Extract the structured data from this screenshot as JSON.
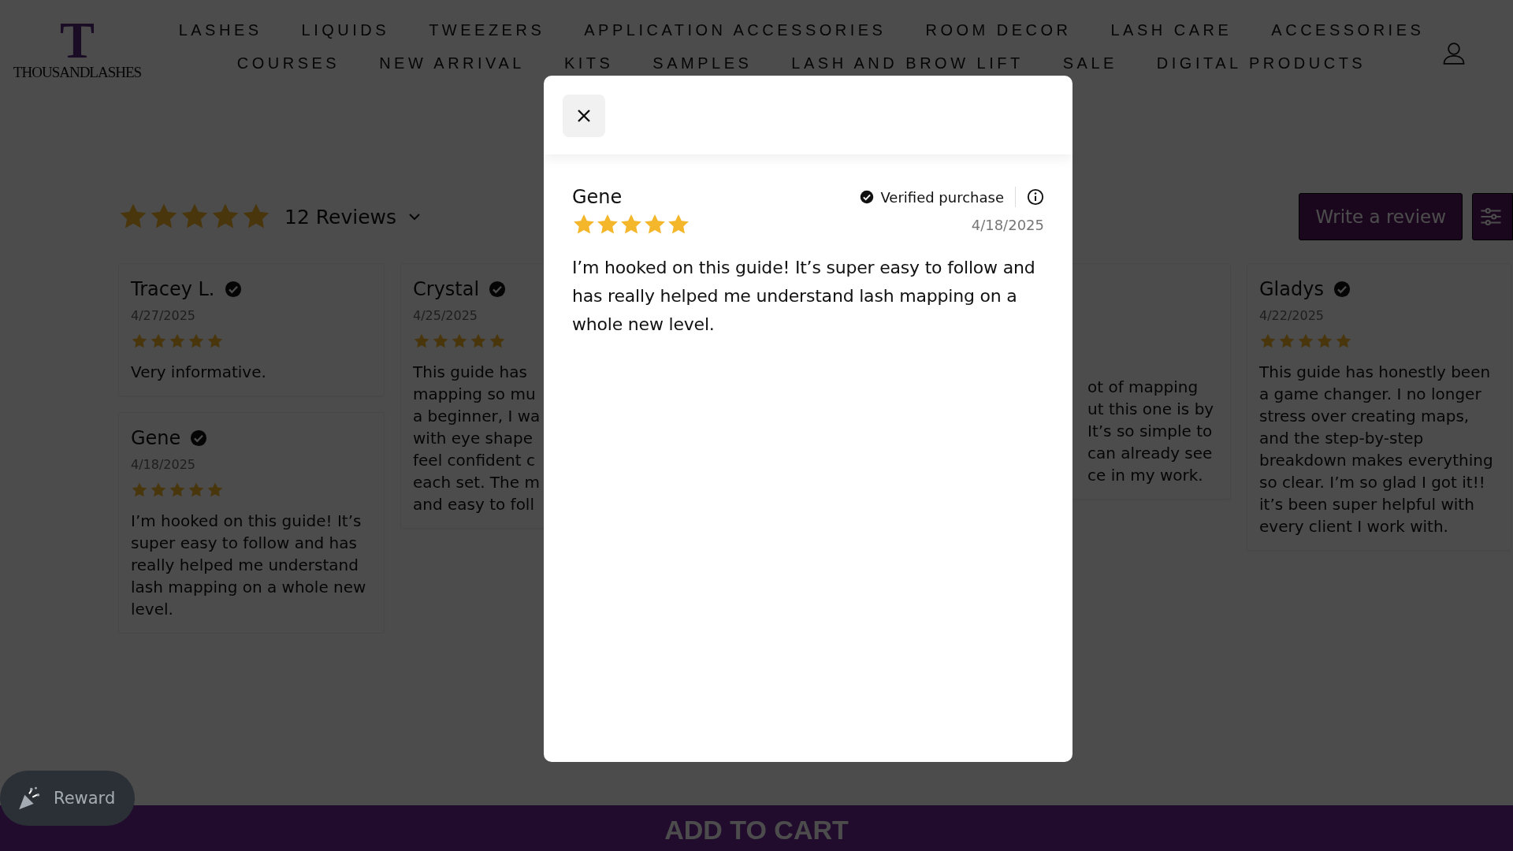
{
  "header": {
    "logo": {
      "letter": "T",
      "wordmark": "THOUSANDLASHES"
    },
    "nav_rows": [
      [
        "LASHES",
        "LIQUIDS",
        "TWEEZERS",
        "APPLICATION ACCESSORIES",
        "ROOM DECOR",
        "LASH CARE",
        "ACCESSORIES"
      ],
      [
        "COURSES",
        "NEW ARRIVAL",
        "KITS",
        "SAMPLES",
        "LASH AND BROW LIFT",
        "SALE",
        "DIGITAL PRODUCTS"
      ]
    ]
  },
  "reviews_summary": {
    "stars": 5,
    "count": "12 Reviews"
  },
  "write_review_button": "Write a review",
  "review_columns": [
    [
      {
        "kind": "full",
        "name": "Tracey L.",
        "verified": true,
        "date": "4/27/2025",
        "stars": 5,
        "body": "Very informative."
      },
      {
        "kind": "full",
        "name": "Gene",
        "verified": true,
        "date": "4/18/2025",
        "stars": 5,
        "body": "I’m hooked on this guide! It’s super easy to follow and has really helped me understand lash mapping on a whole new level."
      }
    ],
    [
      {
        "kind": "cut",
        "name": "Crystal",
        "verified": true,
        "date": "4/25/2025",
        "stars": 5,
        "body_lines": [
          "This guide has",
          "mapping so mu",
          "a beginner, I wa",
          "with eye shape",
          "feel confident c",
          "each set. The m",
          "and easy to foll"
        ]
      }
    ],
    [
      {
        "kind": "hidden-left",
        "body_lines": [
          "ot of mapping",
          "ut this one is by",
          "It’s so simple to",
          "can already see",
          "ce in my work."
        ]
      }
    ],
    [
      {
        "kind": "full",
        "name": "Gladys",
        "verified": true,
        "date": "4/22/2025",
        "stars": 5,
        "body": "This guide has honestly been a game changer. I no longer stress over creating maps, and the step-by-step breakdown makes everything so clear. I’m so glad I got it!! it’s been super helpful with every client I work with."
      }
    ]
  ],
  "reward_button": "Reward",
  "add_to_cart_button": "ADD TO CART",
  "modal": {
    "name": "Gene",
    "verified_label": "Verified purchase",
    "stars": 5,
    "date": "4/18/2025",
    "body": "I’m hooked on this guide! It’s super easy to follow and has really helped me understand lash mapping on a whole new level."
  }
}
